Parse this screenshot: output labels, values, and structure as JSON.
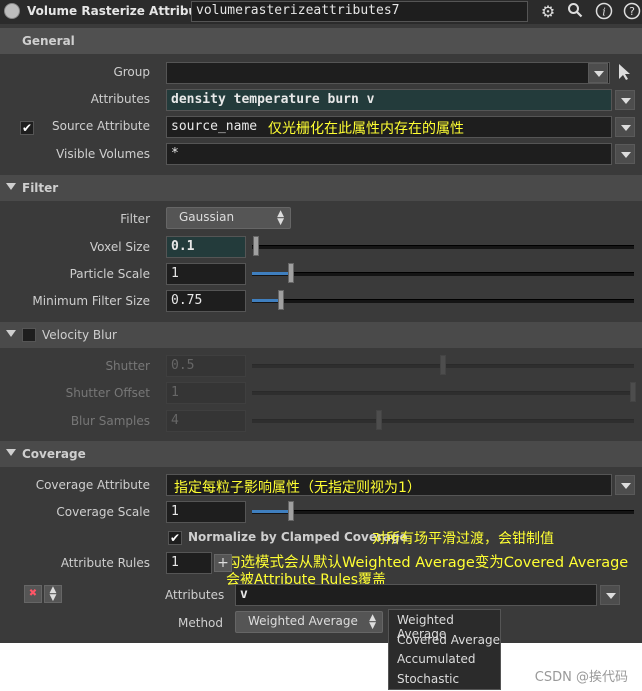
{
  "header": {
    "node_type": "Volume Rasterize Attributes",
    "node_name": "volumerasterizeattributes7",
    "icons": [
      "gear-icon",
      "search-icon",
      "info-icon",
      "help-icon"
    ]
  },
  "general": {
    "title": "General",
    "group_label": "Group",
    "group_value": "",
    "attributes_label": "Attributes",
    "attributes_value": "density temperature burn v",
    "source_attribute_label": "Source Attribute",
    "source_attribute_checked": true,
    "source_attribute_value": "source_name",
    "source_attribute_note": "仅光栅化在此属性内存在的属性",
    "visible_volumes_label": "Visible Volumes",
    "visible_volumes_value": "*"
  },
  "filter": {
    "title": "Filter",
    "filter_label": "Filter",
    "filter_value": "Gaussian",
    "voxel_size_label": "Voxel Size",
    "voxel_size_value": "0.1",
    "voxel_size_slider": 0.0,
    "particle_scale_label": "Particle Scale",
    "particle_scale_value": "1",
    "particle_scale_slider": 0.1,
    "min_filter_label": "Minimum Filter Size",
    "min_filter_value": "0.75",
    "min_filter_slider": 0.08
  },
  "velocity_blur": {
    "title": "Velocity Blur",
    "enabled": false,
    "shutter_label": "Shutter",
    "shutter_value": "0.5",
    "shutter_slider": 0.5,
    "shutter_offset_label": "Shutter Offset",
    "shutter_offset_value": "1",
    "shutter_offset_slider": 1.0,
    "blur_samples_label": "Blur Samples",
    "blur_samples_value": "4",
    "blur_samples_slider": 0.33
  },
  "coverage": {
    "title": "Coverage",
    "coverage_attribute_label": "Coverage Attribute",
    "coverage_attribute_value": "",
    "coverage_attribute_note": "指定每粒子影响属性（无指定则视为1）",
    "coverage_scale_label": "Coverage Scale",
    "coverage_scale_value": "1",
    "coverage_scale_slider": 0.1,
    "normalize_label": "Normalize by Clamped Coverage",
    "normalize_checked": true,
    "normalize_note": "对所有场平滑过渡，会钳制值",
    "rules_note_line1": "勾选模式会从默认Weighted Average变为Covered Average",
    "rules_note_line2": "会被Attribute Rules覆盖",
    "attribute_rules_label": "Attribute Rules",
    "attribute_rules_value": "1",
    "rule_attributes_label": "Attributes",
    "rule_attributes_value": "v",
    "method_label": "Method",
    "method_value": "Weighted Average",
    "method_options": [
      "Weighted Average",
      "Covered Average",
      "Accumulated",
      "Stochastic"
    ]
  },
  "watermark": "CSDN @挨代码",
  "colors": {
    "panel_bg": "#3a3a3a",
    "section_bg": "#4a4a4a",
    "field_bg": "#1e1e1e",
    "slider_fill": "#3f7fbf",
    "annotation": "#ffff33"
  }
}
